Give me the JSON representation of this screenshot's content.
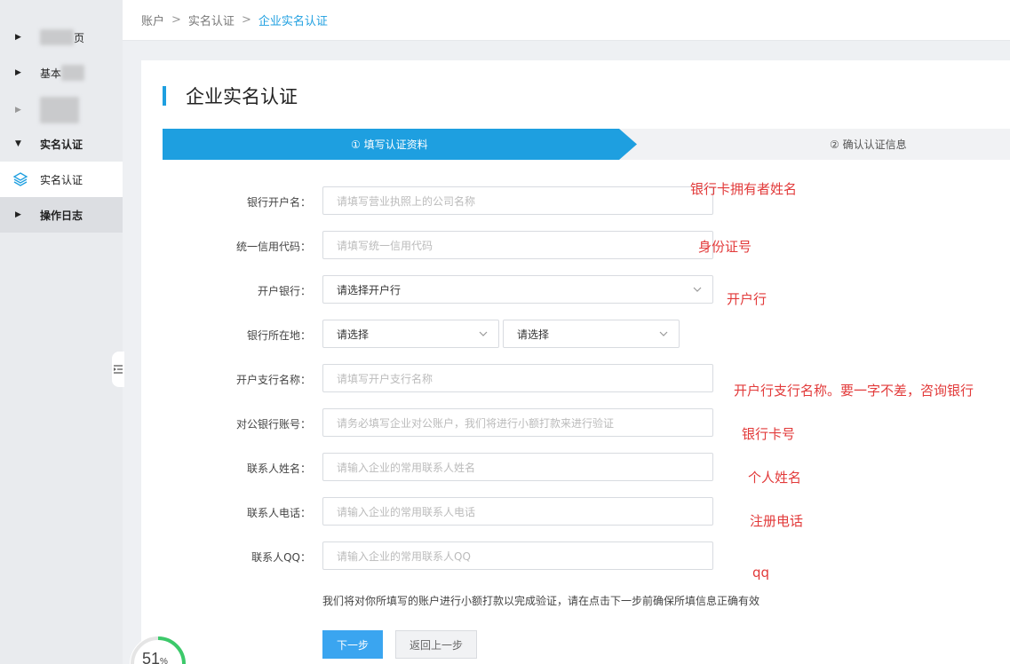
{
  "sidebar": {
    "items": [
      {
        "label_visible": "页",
        "expanded": false
      },
      {
        "label_visible": "基本",
        "expanded": false
      },
      {
        "label_visible": "",
        "expanded": false
      },
      {
        "label": "实名认证",
        "expanded": true
      },
      {
        "label": "实名认证",
        "active": true,
        "icon": "layers-icon"
      },
      {
        "label": "操作日志",
        "expanded": false
      }
    ]
  },
  "breadcrumb": {
    "items": [
      "账户",
      "实名认证",
      "企业实名认证"
    ],
    "separator": ">"
  },
  "page": {
    "title": "企业实名认证",
    "accent_color": "#1e9fe0"
  },
  "steps": [
    {
      "label": "① 填写认证资料",
      "active": true
    },
    {
      "label": "② 确认认证信息",
      "active": false
    }
  ],
  "form": {
    "fields": [
      {
        "label": "银行开户名：",
        "placeholder": "请填写营业执照上的公司名称",
        "note": "银行卡拥有者姓名"
      },
      {
        "label": "统一信用代码：",
        "placeholder": "请填写统一信用代码",
        "note": "身份证号"
      },
      {
        "label": "开户银行：",
        "value": "请选择开户行",
        "type": "select",
        "note": "开户行"
      },
      {
        "label": "银行所在地：",
        "values": [
          "请选择",
          "请选择"
        ],
        "type": "select-pair"
      },
      {
        "label": "开户支行名称：",
        "placeholder": "请填写开户支行名称",
        "note": "开户行支行名称。要一字不差，咨询银行"
      },
      {
        "label": "对公银行账号：",
        "placeholder": "请务必填写企业对公账户，我们将进行小额打款来进行验证",
        "note": "银行卡号"
      },
      {
        "label": "联系人姓名：",
        "placeholder": "请输入企业的常用联系人姓名",
        "note": "个人姓名"
      },
      {
        "label": "联系人电话：",
        "placeholder": "请输入企业的常用联系人电话",
        "note": "注册电话"
      },
      {
        "label": "联系人QQ：",
        "placeholder": "请输入企业的常用联系人QQ",
        "note": "qq"
      }
    ],
    "hint": "我们将对你所填写的账户进行小额打款以完成验证，请在点击下一步前确保所填信息正确有效",
    "next_label": "下一步",
    "back_label": "返回上一步",
    "note_color": "#e23a3a"
  },
  "progress": {
    "value": "51",
    "unit": "%"
  }
}
